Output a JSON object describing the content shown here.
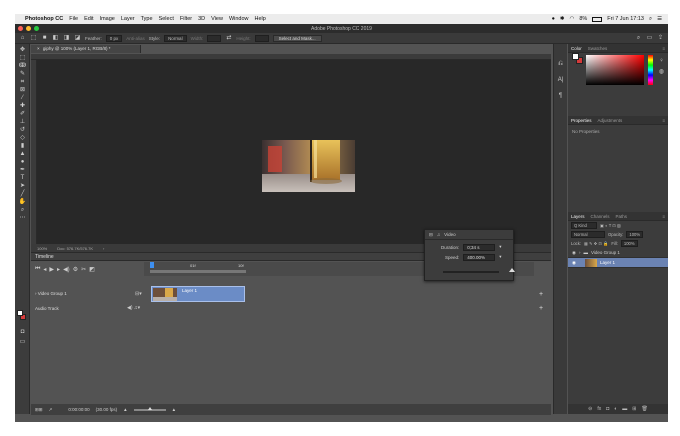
{
  "menubar": {
    "app": "Photoshop CC",
    "items": [
      "File",
      "Edit",
      "Image",
      "Layer",
      "Type",
      "Select",
      "Filter",
      "3D",
      "View",
      "Window",
      "Help"
    ],
    "battery": "8%",
    "clock": "Fri 7 Jun 17:13"
  },
  "window": {
    "title": "Adobe Photoshop CC 2019"
  },
  "options": {
    "feather_label": "Feather:",
    "feather_value": "0 px",
    "antialias": "Anti-alias",
    "style_label": "Style:",
    "style_value": "Normal",
    "width_label": "Width:",
    "height_label": "Height:",
    "select_mask": "Select and Mask..."
  },
  "document": {
    "tab": "giphy @ 100% (Layer 1, RGB/8) *"
  },
  "status": {
    "zoom": "100%",
    "doc": "Doc: 576.7K/576.7K"
  },
  "timeline": {
    "title": "Timeline",
    "marker_a": "01f",
    "marker_b": "10f",
    "video_group": "Video Group 1",
    "clip_label": "Layer 1",
    "audio_track": "Audio Track",
    "timecode": "0:00:00:00",
    "fps": "(30.00 fps)"
  },
  "popup": {
    "title": "Video",
    "duration_label": "Duration:",
    "duration_value": "0;34 s",
    "speed_label": "Speed:",
    "speed_value": "400.00%"
  },
  "panels": {
    "color_tabs": [
      "Color",
      "Swatches"
    ],
    "props_tabs": [
      "Properties",
      "Adjustments"
    ],
    "props_text": "No Properties",
    "layers_tabs": [
      "Layers",
      "Channels",
      "Paths"
    ],
    "kind": "Q Kind",
    "blend": "Normal",
    "opacity_label": "Opacity:",
    "opacity_value": "100%",
    "lock_label": "Lock:",
    "fill_label": "Fill:",
    "fill_value": "100%",
    "layers": [
      "Video Group 1",
      "Layer 1"
    ]
  },
  "colors": {
    "fg": "#ffffff",
    "bg": "#d43a3a",
    "clip": "#6b8cc6",
    "selected_layer": "#6b83b3"
  }
}
